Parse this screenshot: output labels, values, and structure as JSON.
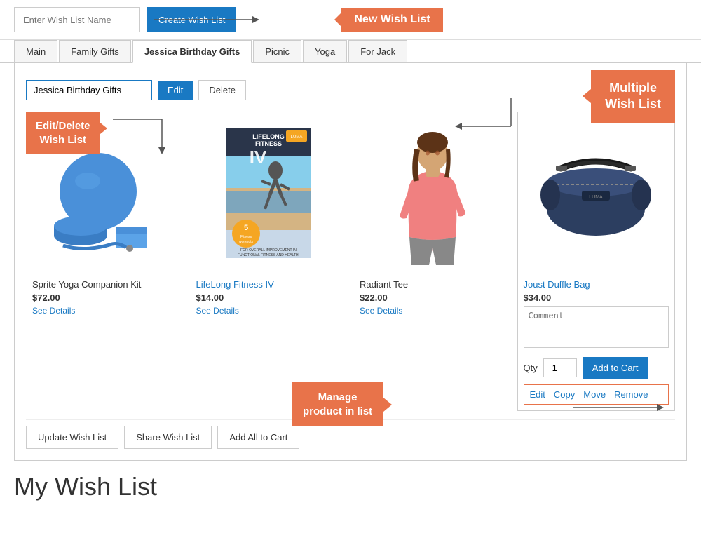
{
  "topBar": {
    "inputPlaceholder": "Enter Wish List Name",
    "createBtnLabel": "Create Wish List",
    "newWishListCallout": "New Wish List"
  },
  "tabs": [
    {
      "label": "Main",
      "active": false
    },
    {
      "label": "Family Gifts",
      "active": false
    },
    {
      "label": "Jessica Birthday Gifts",
      "active": true
    },
    {
      "label": "Picnic",
      "active": false
    },
    {
      "label": "Yoga",
      "active": false
    },
    {
      "label": "For Jack",
      "active": false
    }
  ],
  "editRow": {
    "nameValue": "Jessica Birthday Gifts",
    "editLabel": "Edit",
    "deleteLabel": "Delete"
  },
  "callouts": {
    "editDelete": "Edit/Delete\nWish List",
    "multipleWishList": "Multiple\nWish List",
    "manageProduct": "Manage\nproduct in list"
  },
  "products": [
    {
      "name": "Sprite Yoga Companion Kit",
      "nameIsLink": false,
      "price": "$72.00",
      "detailsLabel": "See Details",
      "type": "yoga"
    },
    {
      "name": "LifeLong Fitness IV",
      "nameIsLink": true,
      "price": "$14.00",
      "detailsLabel": "See Details",
      "type": "fitness"
    },
    {
      "name": "Radiant Tee",
      "nameIsLink": false,
      "price": "$22.00",
      "detailsLabel": "See Details",
      "type": "tee"
    },
    {
      "name": "Joust Duffle Bag",
      "nameIsLink": true,
      "price": "$34.00",
      "commentPlaceholder": "Comment",
      "qtyLabel": "Qty",
      "qtyValue": "1",
      "addToCartLabel": "Add to Cart",
      "actionLinks": [
        "Edit",
        "Copy",
        "Move",
        "Remove"
      ],
      "type": "bag"
    }
  ],
  "bottomButtons": {
    "updateLabel": "Update Wish List",
    "shareLabel": "Share Wish List",
    "addAllLabel": "Add All to Cart"
  },
  "pageTitle": "My Wish List"
}
